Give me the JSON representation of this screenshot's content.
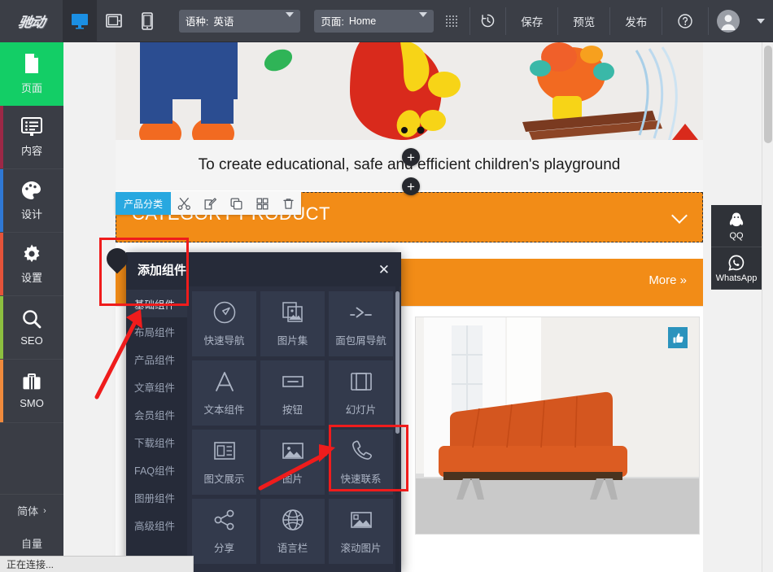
{
  "app": {
    "logo_text": "驰动",
    "status_text": "正在连接..."
  },
  "toolbar": {
    "devices": [
      {
        "name": "desktop",
        "label": "桌面端",
        "active": true
      },
      {
        "name": "tablet",
        "label": "平板端",
        "active": false
      },
      {
        "name": "mobile",
        "label": "手机端",
        "active": false
      }
    ],
    "language_field": {
      "label": "语种:",
      "value": "英语"
    },
    "page_field": {
      "label": "页面:",
      "value": "Home"
    },
    "grid_icon": "grid-dots-icon",
    "history_icon": "history-icon",
    "save_label": "保存",
    "preview_label": "预览",
    "publish_label": "发布",
    "help_icon": "question-circle-icon",
    "account_icon": "user-avatar-icon",
    "account_caret": "chevron-down-icon"
  },
  "sidebar": {
    "items": [
      {
        "label": "页面",
        "icon": "page-icon",
        "stripe": "#13ce66",
        "active": true
      },
      {
        "label": "内容",
        "icon": "content-list-icon",
        "stripe": "#9c2846",
        "active": false
      },
      {
        "label": "设计",
        "icon": "palette-icon",
        "stripe": "#2f78d4",
        "active": false
      },
      {
        "label": "设置",
        "icon": "gear-icon",
        "stripe": "#e4533a",
        "active": false
      },
      {
        "label": "SEO",
        "icon": "search-icon",
        "stripe": "#8cbf3f",
        "active": false
      },
      {
        "label": "SMO",
        "icon": "briefcase-icon",
        "stripe": "#f08a3c",
        "active": false
      }
    ],
    "language_switch": {
      "label": "简体",
      "icon": "chevron-right-icon"
    },
    "bottom_item": {
      "label": "自量"
    }
  },
  "canvas": {
    "hero": {
      "alt": "children toy figures banner"
    },
    "tagline": "To create educational, safe and efficient children's playground",
    "category_band": {
      "title": "CATEGORY PRODUCT",
      "chevron": "chevron-down-icon",
      "color": "#f28c17"
    },
    "more_band": {
      "more_label": "More »",
      "color": "#f28c17"
    },
    "product_card": {
      "alt": "orange leather sofa",
      "badge_icon": "thumbs-up-icon"
    },
    "element_toolbar": {
      "tag_label": "产品分类",
      "tag_color": "#28a8e0",
      "actions": [
        {
          "name": "cut",
          "icon": "scissors-icon"
        },
        {
          "name": "edit",
          "icon": "edit-pencil-icon"
        },
        {
          "name": "copy",
          "icon": "copy-icon"
        },
        {
          "name": "layout",
          "icon": "grid-layout-icon"
        },
        {
          "name": "delete",
          "icon": "trash-icon"
        }
      ]
    },
    "add_buttons": [
      {
        "name": "insert-above",
        "label": "+"
      },
      {
        "name": "insert-below",
        "label": "+"
      }
    ],
    "float_social": [
      {
        "label": "QQ",
        "icon": "qq-penguin-icon"
      },
      {
        "label": "WhatsApp",
        "icon": "whatsapp-icon"
      }
    ]
  },
  "add_panel": {
    "title": "添加组件",
    "close_icon": "close-icon",
    "categories": [
      {
        "label": "基础组件",
        "active": true
      },
      {
        "label": "布局组件",
        "active": false
      },
      {
        "label": "产品组件",
        "active": false
      },
      {
        "label": "文章组件",
        "active": false
      },
      {
        "label": "会员组件",
        "active": false
      },
      {
        "label": "下载组件",
        "active": false
      },
      {
        "label": "FAQ组件",
        "active": false
      },
      {
        "label": "图册组件",
        "active": false
      },
      {
        "label": "高级组件",
        "active": false
      }
    ],
    "components": [
      {
        "label": "快速导航",
        "icon": "navigation-compass-icon"
      },
      {
        "label": "图片集",
        "icon": "image-stack-icon"
      },
      {
        "label": "面包屑导航",
        "icon": "breadcrumb-icon"
      },
      {
        "label": "文本组件",
        "icon": "text-a-icon"
      },
      {
        "label": "按钮",
        "icon": "button-rect-icon"
      },
      {
        "label": "幻灯片",
        "icon": "slideshow-icon"
      },
      {
        "label": "图文展示",
        "icon": "image-text-icon"
      },
      {
        "label": "图片",
        "icon": "image-icon"
      },
      {
        "label": "快速联系",
        "icon": "phone-icon"
      },
      {
        "label": "分享",
        "icon": "share-icon"
      },
      {
        "label": "语言栏",
        "icon": "globe-icon"
      },
      {
        "label": "滚动图片",
        "icon": "scroll-image-icon"
      }
    ]
  },
  "annotations": {
    "color": "#ef1c1c",
    "boxes": [
      {
        "name": "highlight-add-component-header",
        "target": "添加组件 / 基础组件"
      },
      {
        "name": "highlight-quick-contact",
        "target": "快速联系"
      }
    ],
    "arrows": [
      {
        "name": "arrow-to-basic-components"
      },
      {
        "name": "arrow-to-quick-contact"
      }
    ]
  }
}
